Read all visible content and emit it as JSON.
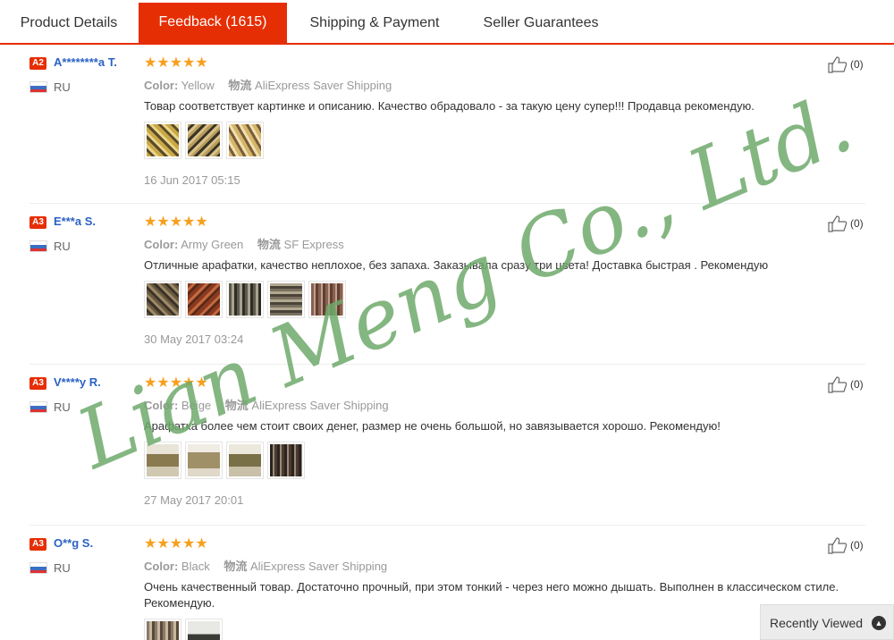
{
  "tabs": [
    {
      "label": "Product Details"
    },
    {
      "label": "Feedback (1615)"
    },
    {
      "label": "Shipping & Payment"
    },
    {
      "label": "Seller Guarantees"
    }
  ],
  "stars": "★★★★★",
  "color_key": "Color:",
  "shipping_key": "物流",
  "reviews": [
    {
      "badge": "A2",
      "user": "A********a T.",
      "country": "RU",
      "color": "Yellow",
      "shipping": "AliExpress Saver Shipping",
      "text": "Товар соответствует картинке и описанию. Качество обрадовало - за такую цену супер!!! Продавца рекомендую.",
      "date": "16 Jun 2017 05:15",
      "likes": "(0)"
    },
    {
      "badge": "A3",
      "user": "E***a S.",
      "country": "RU",
      "color": "Army Green",
      "shipping": "SF Express",
      "text": "Отличные арафатки, качество неплохое, без запаха. Заказывала сразу три цвета! Доставка быстрая . Рекомендую",
      "date": "30 May 2017 03:24",
      "likes": "(0)"
    },
    {
      "badge": "A3",
      "user": "V****y R.",
      "country": "RU",
      "color": "Beige",
      "shipping": "AliExpress Saver Shipping",
      "text": "Арафатка более чем стоит своих денег, размер не очень большой, но завязывается хорошо. Рекомендую!",
      "date": "27 May 2017 20:01",
      "likes": "(0)"
    },
    {
      "badge": "A3",
      "user": "O**g S.",
      "country": "RU",
      "color": "Black",
      "shipping": "AliExpress Saver Shipping",
      "text": "Очень качественный товар. Достаточно прочный, при этом тонкий - через него можно дышать. Выполнен в классическом стиле. Рекомендую.",
      "likes": "(0)"
    }
  ],
  "recently_viewed": "Recently Viewed",
  "watermark": "Lian Meng Co., Ltd.",
  "colors": {
    "accent": "#e62e04",
    "username": "#2b62c4",
    "stars": "#f7a01e",
    "watermark": "#6fa96b"
  }
}
